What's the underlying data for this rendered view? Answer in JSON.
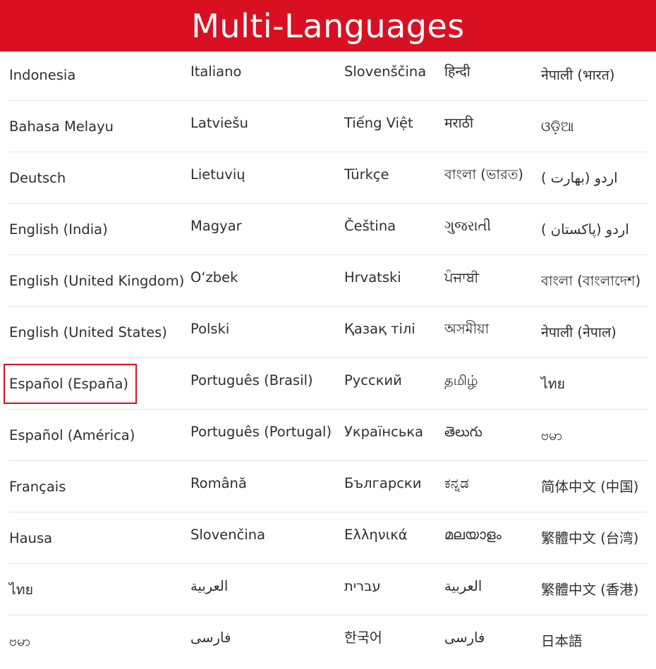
{
  "header": {
    "title": "Multi-Languages"
  },
  "colors": {
    "accent": "#d91021",
    "text": "#2f2f2f",
    "divider": "#e3e3e3"
  },
  "languages": {
    "rows": [
      [
        "Indonesia",
        "Italiano",
        "Slovenščina",
        "हिन्दी",
        "नेपाली (भारत)"
      ],
      [
        "Bahasa Melayu",
        "Latviešu",
        "Tiếng Việt",
        "मराठी",
        "ଓଡ଼ିଆ"
      ],
      [
        "Deutsch",
        "Lietuvių",
        "Türkçe",
        "বাংলা (ভারত)",
        "اردو (بھارت )"
      ],
      [
        "English (India)",
        "Magyar",
        "Čeština",
        "ગુજરાતી",
        "اردو (پاکستان )"
      ],
      [
        "English (United Kingdom)",
        "O‘zbek",
        "Hrvatski",
        "ਪੰਜਾਬੀ",
        "বাংলা (বাংলাদেশ)"
      ],
      [
        "English (United States)",
        "Polski",
        "Қазақ тілі",
        "অসমীয়া",
        "नेपाली (नेपाल)"
      ],
      [
        "Español (España)",
        "Português (Brasil)",
        "Русский",
        "தமிழ்",
        "ไทย"
      ],
      [
        "Español (América)",
        "Português (Portugal)",
        "Українська",
        "తెలుగు",
        "ဗမာ"
      ],
      [
        "Français",
        "Română",
        "Български",
        "ಕನ್ನಡ",
        "简体中文 (中国)"
      ],
      [
        "Hausa",
        "Slovenčina",
        "Ελληνικά",
        "മലയാളം",
        "繁體中文 (台湾)"
      ],
      [
        "ไทย",
        "العربية",
        "עברית",
        "العربية",
        "繁體中文 (香港)"
      ],
      [
        "ဗမာ",
        "فارسی",
        "한국어",
        "فارسی",
        "日本語"
      ]
    ],
    "selected": "Español (España)"
  }
}
